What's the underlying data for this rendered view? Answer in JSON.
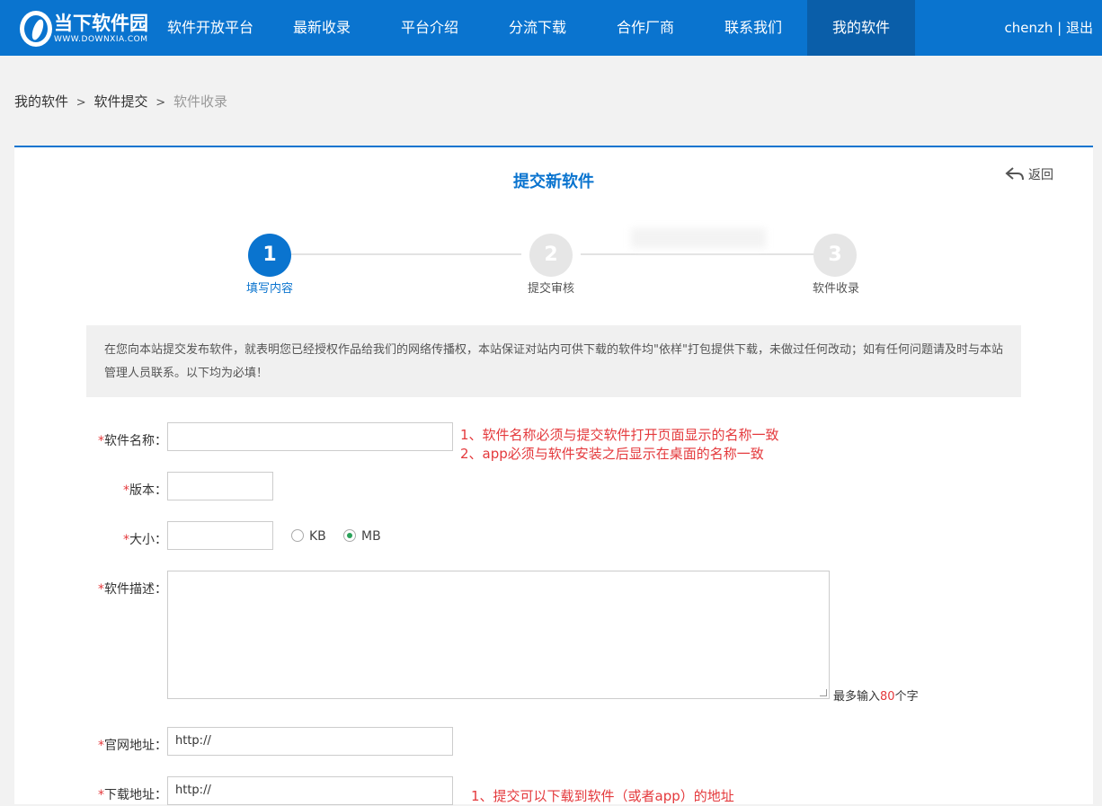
{
  "header": {
    "logo_cn": "当下软件园",
    "logo_en": "WWW.DOWNXIA.COM",
    "nav": [
      "软件开放平台",
      "最新收录",
      "平台介绍",
      "分流下载",
      "合作厂商",
      "联系我们",
      "我的软件"
    ],
    "active_nav": "我的软件",
    "user_name": "chenzh",
    "user_sep": " | ",
    "logout": "退出"
  },
  "breadcrumb": {
    "items": [
      "我的软件",
      "软件提交",
      "软件收录"
    ],
    "sep": ">"
  },
  "page": {
    "title": "提交新软件",
    "back": "返回"
  },
  "steps": [
    {
      "num": "1",
      "label": "填写内容",
      "active": true
    },
    {
      "num": "2",
      "label": "提交审核",
      "active": false
    },
    {
      "num": "3",
      "label": "软件收录",
      "active": false
    }
  ],
  "notice": "在您向本站提交发布软件，就表明您已经授权作品给我们的网络传播权，本站保证对站内可供下载的软件均\"依样\"打包提供下载，未做过任何改动；如有任何问题请及时与本站管理人员联系。以下均为必填！",
  "form": {
    "required_mark": "*",
    "name_label": "软件名称：",
    "version_label": "版本：",
    "size_label": "大小：",
    "size_units": [
      "KB",
      "MB"
    ],
    "size_selected": "MB",
    "desc_label": "软件描述：",
    "desc_max_prefix": "最多输入",
    "desc_max_num": "80",
    "desc_max_suffix": "个字",
    "site_label": "官网地址：",
    "site_value": "http://",
    "download_label": "下载地址：",
    "download_value": "http://"
  },
  "hints": {
    "name_1": "1、软件名称必须与提交软件打开页面显示的名称一致",
    "name_2": "2、app必须与软件安装之后显示在桌面的名称一致",
    "download_1": "1、提交可以下载到软件（或者app）的地址"
  },
  "colors": {
    "brand": "#0a74cf",
    "nav_active": "#0a5ea9",
    "warning": "#e4393c",
    "radio_on": "#2aa25a"
  }
}
